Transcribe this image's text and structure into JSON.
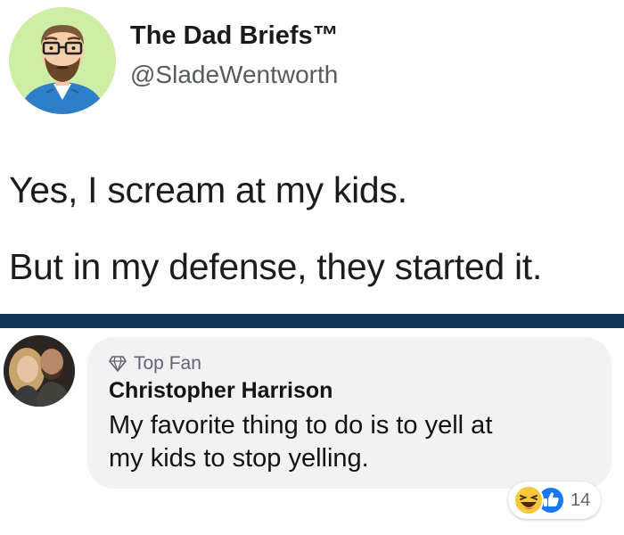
{
  "tweet": {
    "display_name": "The Dad Briefs™",
    "handle": "@SladeWentworth",
    "lines": [
      "Yes, I scream at my kids.",
      "But in my defense, they started it."
    ],
    "avatar_icon": "cartoon-dad-avatar"
  },
  "comment": {
    "badge_icon": "diamond-icon",
    "badge_label": "Top Fan",
    "author": "Christopher Harrison",
    "text_lines": [
      "My favorite thing to do is to yell at",
      "my kids to stop yelling."
    ],
    "avatar_icon": "couple-photo-avatar"
  },
  "reactions": {
    "icons": [
      "haha-reaction-icon",
      "like-reaction-icon"
    ],
    "count": "14"
  },
  "colors": {
    "divider": "#0d3557",
    "bubble": "#f0f2f5",
    "avatar_bg": "#cfeea5",
    "like_blue": "#1877f2",
    "haha_yellow": "#f7c83a"
  }
}
